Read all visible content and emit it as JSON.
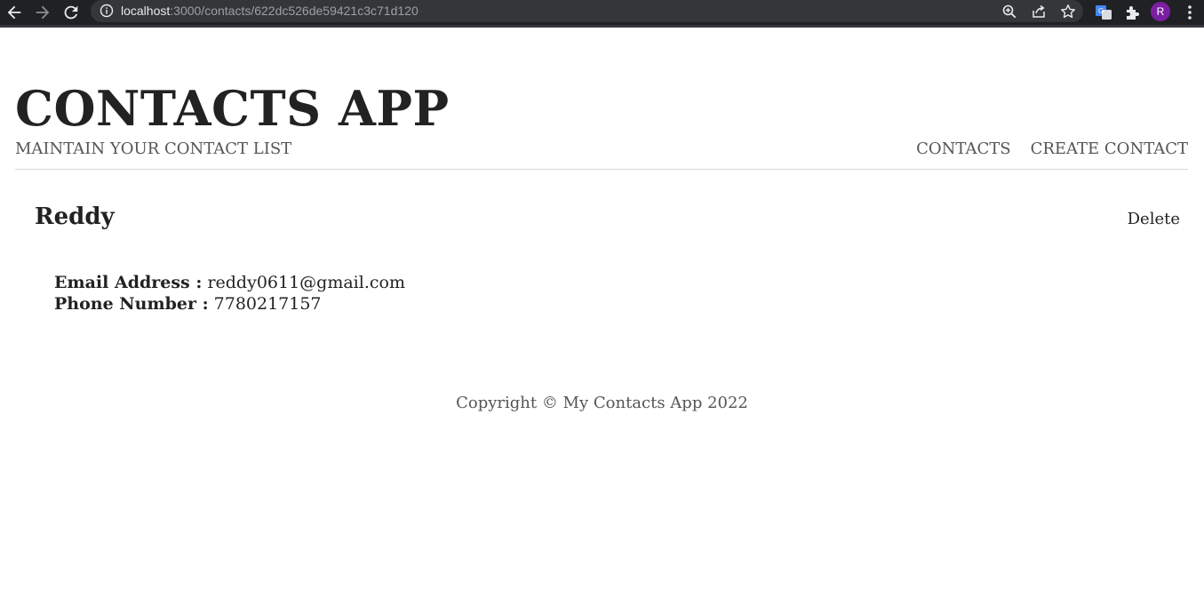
{
  "browser": {
    "url_host": "localhost",
    "url_rest": ":3000/contacts/622dc526de59421c3c71d120",
    "profile_initial": "R"
  },
  "header": {
    "title": "CONTACTS APP",
    "subtitle": "MAINTAIN YOUR CONTACT LIST",
    "nav": {
      "contacts": "CONTACTS",
      "create_contact": "CREATE CONTACT"
    }
  },
  "contact": {
    "name": "Reddy",
    "delete_label": "Delete",
    "email_label": "Email Address :",
    "email_value": "reddy0611@gmail.com",
    "phone_label": "Phone Number :",
    "phone_value": "7780217157"
  },
  "footer": {
    "copyright": "Copyright © My Contacts App 2022"
  },
  "colors": {
    "chrome_bg": "#202124",
    "omnibox_bg": "#35363a",
    "avatar_bg": "#7b1fa2",
    "text_dark": "#222222",
    "text_muted": "#555555",
    "divider": "#d6d6d6"
  }
}
